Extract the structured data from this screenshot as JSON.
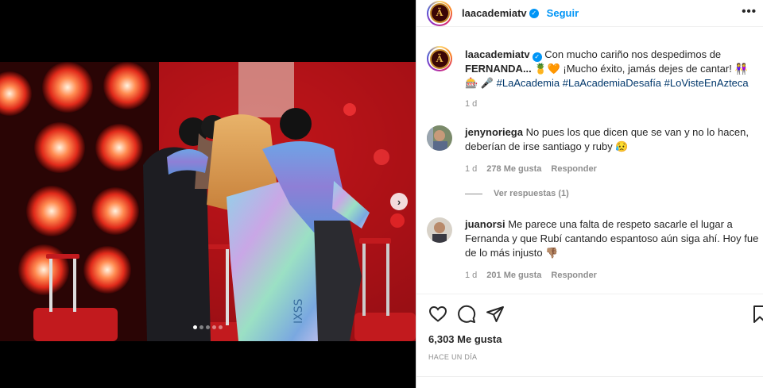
{
  "post": {
    "username": "laacademiatv",
    "follow_label": "Seguir",
    "more_label": "•••",
    "avatar_letter": "Ã"
  },
  "caption": {
    "username": "laacademiatv",
    "text_part1": "Con mucho cariño nos despedimos de",
    "text_bold": "FERNANDA...",
    "text_part2": "🍍🧡 ¡Mucho éxito, jamás dejes de cantar! 👭🎰",
    "text_part3": "🎤",
    "hashtags": "#LaAcademia #LaAcademiaDesafía #LoVisteEnAzteca",
    "time": "1 d"
  },
  "comments": [
    {
      "username": "jenynoriega",
      "text": "No pues los que dicen que se van y no lo hacen, deberían de irse santiago y ruby 😥",
      "time": "1 d",
      "likes": "278 Me gusta",
      "reply": "Responder",
      "view_replies": "Ver respuestas (1)"
    },
    {
      "username": "juanorsi",
      "text": "Me parece una falta de respeto sacarle el lugar a Fernanda y que Rubí cantando espantoso aún siga ahí. Hoy fue de lo más injusto 👎🏽",
      "time": "1 d",
      "likes": "201 Me gusta",
      "reply": "Responder"
    }
  ],
  "footer": {
    "likes": "6,303 Me gusta",
    "posted_ago": "HACE UN DÍA"
  },
  "carousel": {
    "next_label": "›",
    "slide_count": 5,
    "active_index": 0
  },
  "icons": [
    "heart-icon",
    "comment-icon",
    "share-icon",
    "bookmark-icon",
    "verified-badge-icon",
    "chevron-right-icon"
  ],
  "colors": {
    "accent": "#0095f6",
    "hashtag": "#00376b",
    "muted": "#8e8e8e",
    "stage_red": "#c8141a"
  }
}
